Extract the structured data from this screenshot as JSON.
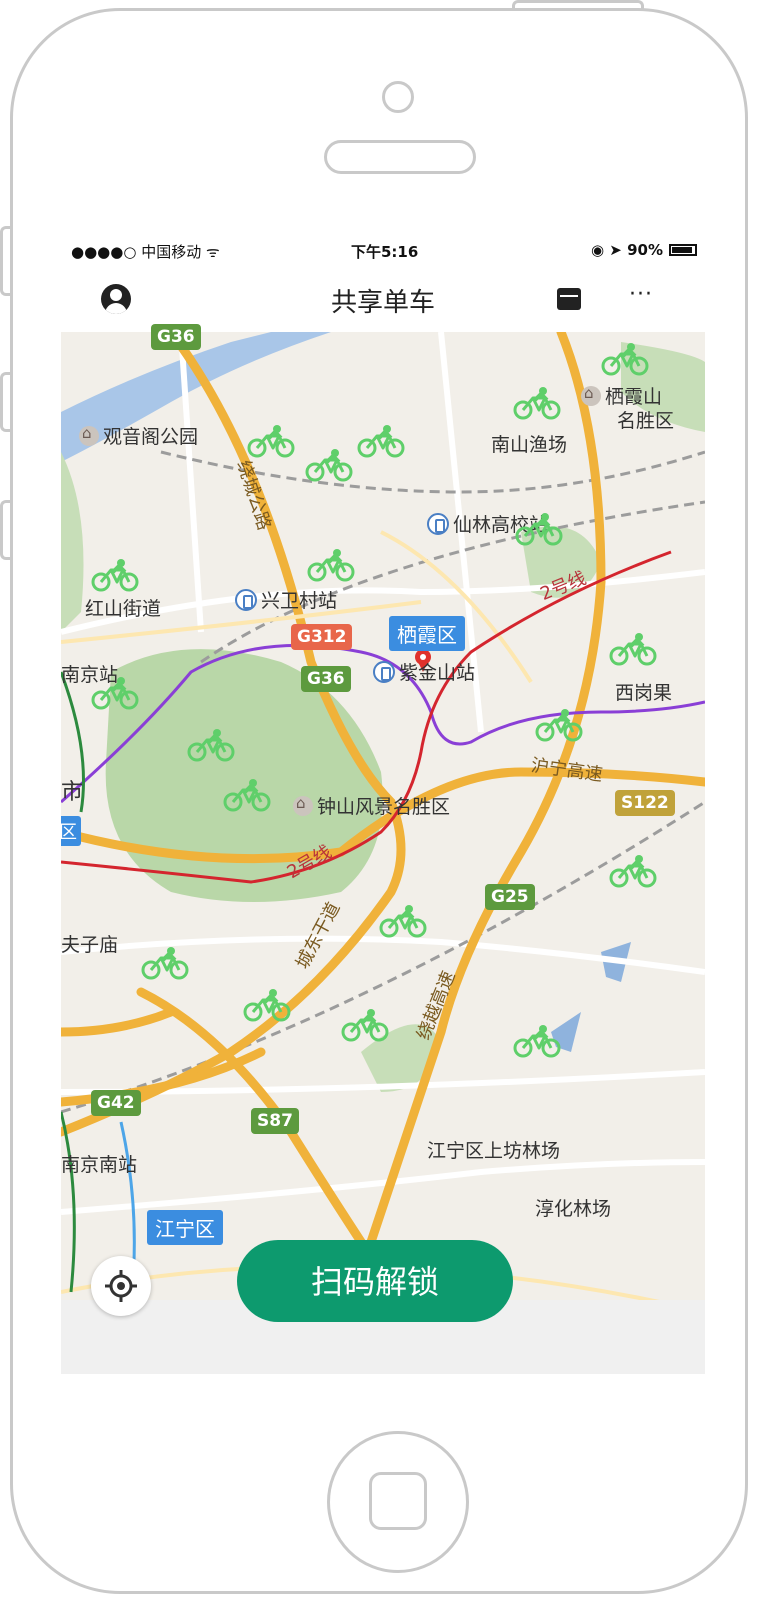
{
  "status_bar": {
    "carrier": "●●●●○ 中国移动 ᯤ",
    "time": "下午5:16",
    "battery": "◉ ➤ 90%"
  },
  "nav": {
    "title": "共享单车",
    "avatar_icon": "user-avatar-icon",
    "calendar_icon": "calendar-icon",
    "more_label": "···"
  },
  "map": {
    "labels": {
      "guanyinge": "观音阁公园",
      "nanshan": "南山渔场",
      "qixiashan_1": "栖霞山",
      "qixiashan_2": "名胜区",
      "xianlin": "仙林高校站",
      "hongshan": "红山街道",
      "xingwei": "兴卫村站",
      "nanjingzhan": "南京站",
      "zijinshan": "紫金山站",
      "xigangguo": "西岗果",
      "zhongshan": "钟山风景名胜区",
      "fuzimiao": "夫子庙",
      "nanjingnan": "南京南站",
      "jiangning_forest": "江宁区上坊林场",
      "chunhua": "淳化林场",
      "shi": "市",
      "qu": "区"
    },
    "districts": {
      "qixia": "栖霞区",
      "jiangning": "江宁区"
    },
    "roads": {
      "g36_top": "G36",
      "g312": "G312",
      "g36": "G36",
      "s122": "S122",
      "g25": "G25",
      "g42": "G42",
      "s87": "S87",
      "line2_a": "2号线",
      "line2_b": "2号线",
      "huning": "沪宁高速",
      "raocheng": "绕城公路",
      "chengdong": "城东干道",
      "raoyue": "绕越高速"
    },
    "colors": {
      "bike": "#5fcf6a",
      "road": "#f0b23a",
      "metro_purple": "#8a3fd6",
      "metro_red": "#d4252e",
      "park": "#b7d8a9",
      "water": "#8fb3dd"
    }
  },
  "actions": {
    "scan_unlock": "扫码解锁",
    "locate_icon": "locate-crosshair-icon"
  }
}
